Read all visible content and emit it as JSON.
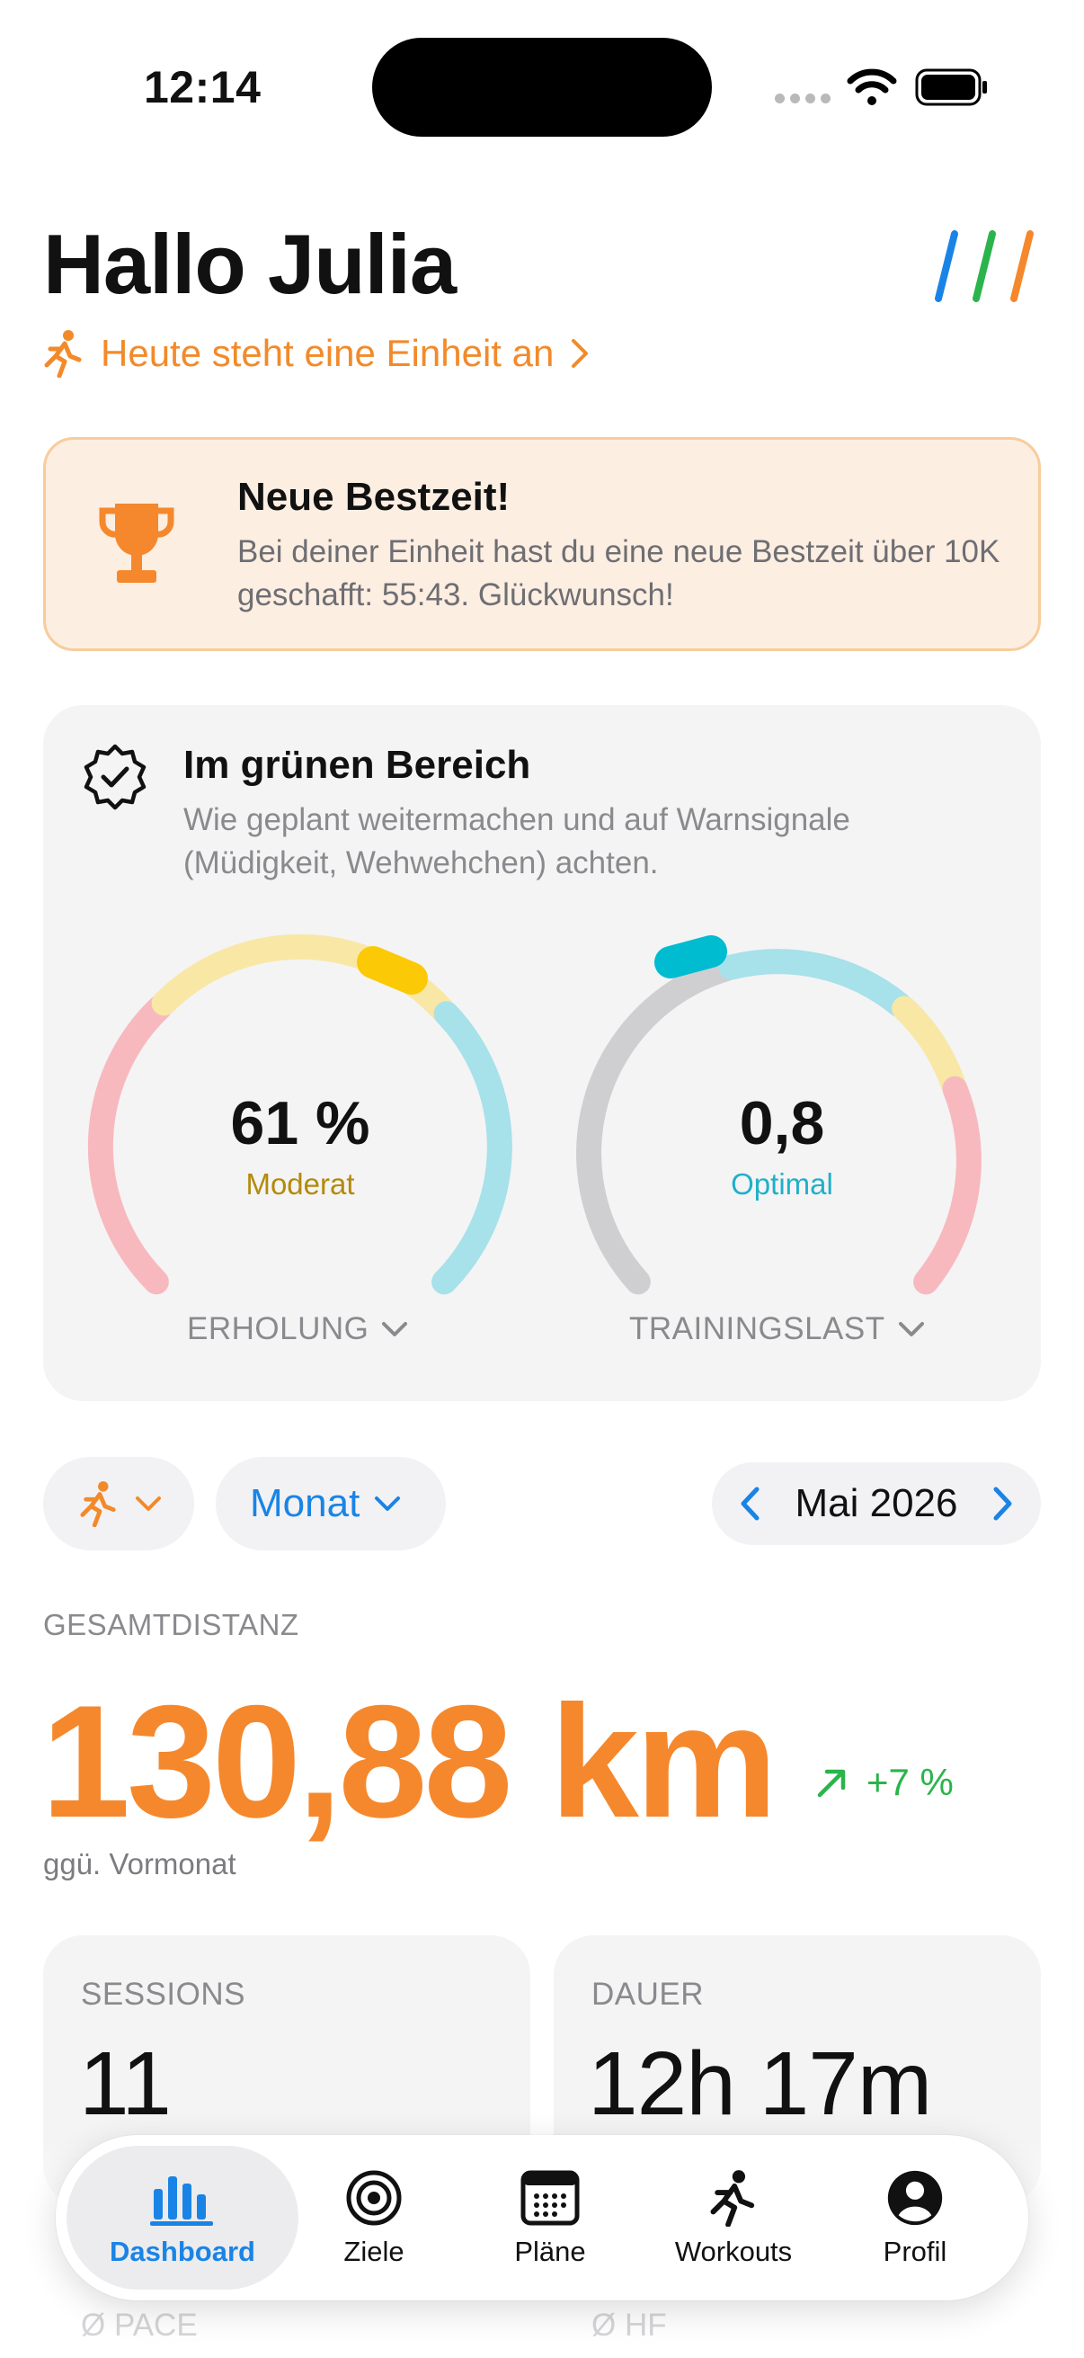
{
  "status_bar": {
    "time": "12:14",
    "icons": [
      "signal-icon",
      "wifi-icon",
      "battery-icon"
    ]
  },
  "header": {
    "greeting": "Hallo Julia",
    "subtitle": "Heute steht eine Einheit an",
    "logo_colors": [
      "#1a84e6",
      "#2bb44b",
      "#f5882c"
    ]
  },
  "highlight": {
    "title": "Neue Bestzeit!",
    "text": "Bei deiner Einheit hast du eine neue Bestzeit über 10K geschafft: 55:43. Glückwunsch!",
    "icon": "trophy-icon"
  },
  "status": {
    "title": "Im grünen Bereich",
    "text": "Wie geplant weitermachen und auf Warnsignale (Müdigkeit, Wehwehchen) achten.",
    "icon": "badge-check-icon",
    "gauges": [
      {
        "value": "61 %",
        "status": "Moderat",
        "label": "ERHOLUNG",
        "level": 0.61,
        "status_color": "#b38a0a"
      },
      {
        "value": "0,8",
        "status": "Optimal",
        "label": "TRAININGSLAST",
        "level": 0.8,
        "status_color": "#1fb0c9"
      }
    ]
  },
  "filters": {
    "activity_icon": "running-icon",
    "period": "Monat",
    "date": "Mai 2026"
  },
  "summary": {
    "label": "GESAMTDISTANZ",
    "value": "130,88 km",
    "change": "+7 %",
    "compare": "ggü. Vormonat"
  },
  "stats": [
    {
      "label": "SESSIONS",
      "value": "11"
    },
    {
      "label": "DAUER",
      "value": "12h 17m"
    },
    {
      "label": "Ø PACE"
    },
    {
      "label": "Ø HF"
    }
  ],
  "tabs": [
    {
      "label": "Dashboard",
      "icon": "chart-bars-icon",
      "active": true
    },
    {
      "label": "Ziele",
      "icon": "target-icon"
    },
    {
      "label": "Pläne",
      "icon": "calendar-icon"
    },
    {
      "label": "Workouts",
      "icon": "running-icon"
    },
    {
      "label": "Profil",
      "icon": "person-icon"
    }
  ],
  "colors": {
    "accent_orange": "#f5882c",
    "accent_blue": "#1a84e6",
    "positive_green": "#2bb44b"
  }
}
